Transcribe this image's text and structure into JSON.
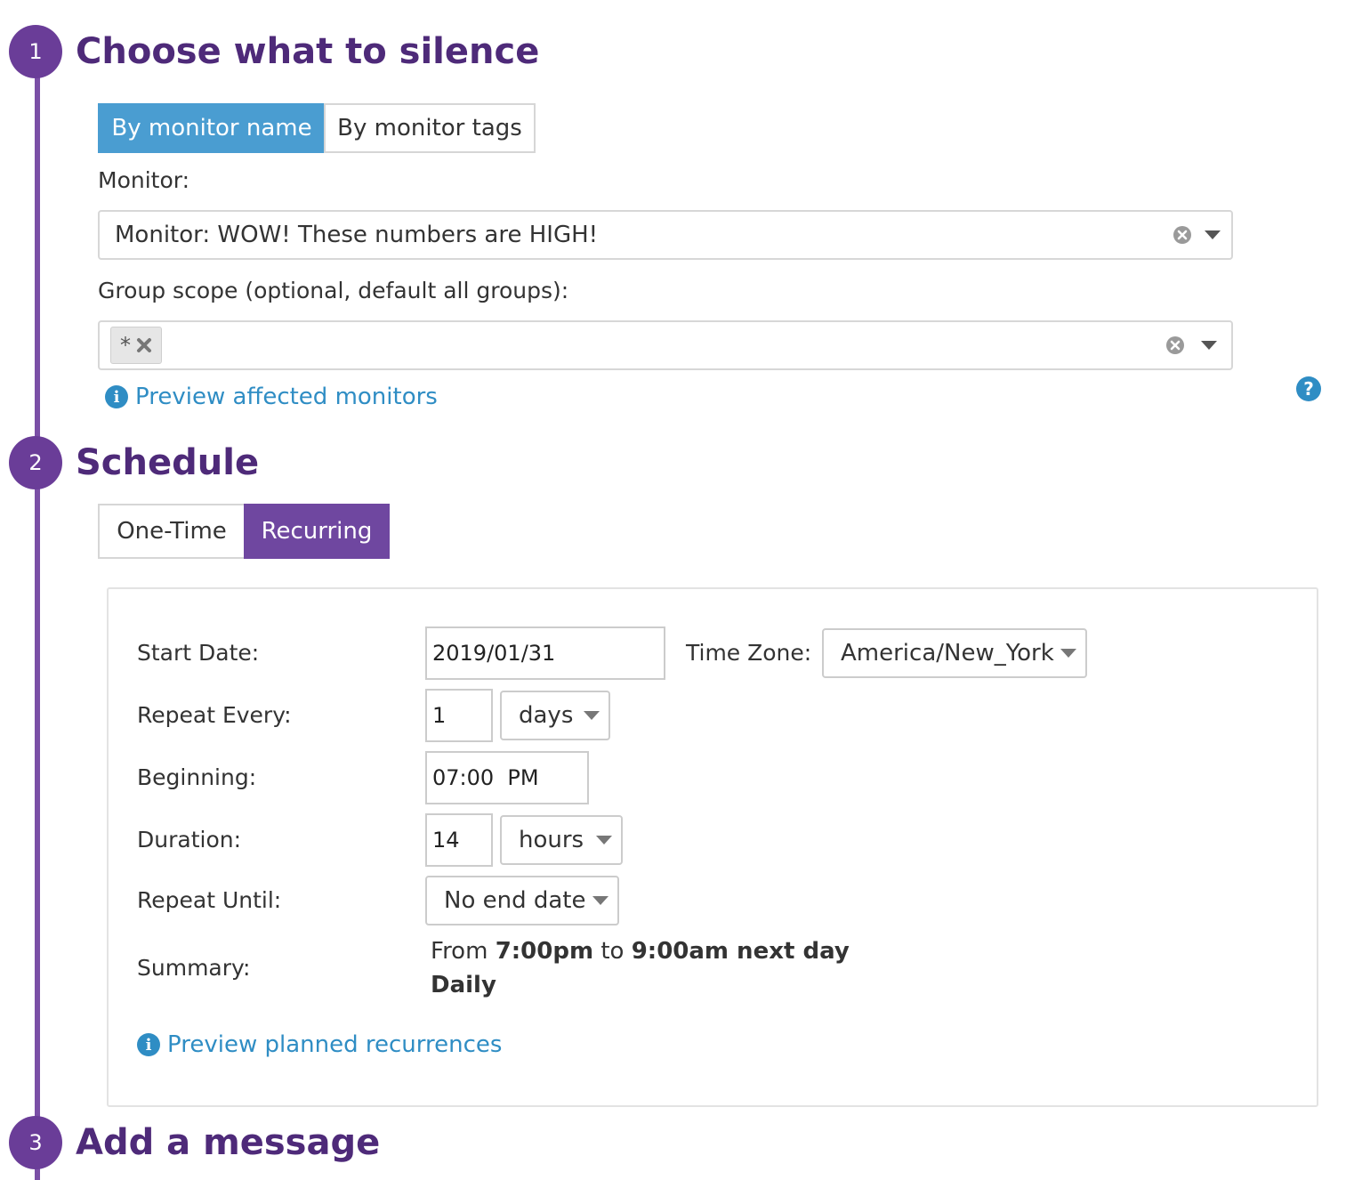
{
  "steps": [
    {
      "number": "1",
      "title": "Choose what to silence"
    },
    {
      "number": "2",
      "title": "Schedule"
    },
    {
      "number": "3",
      "title": "Add a message"
    }
  ],
  "silence": {
    "tabs": [
      {
        "label": "By monitor name",
        "active": true
      },
      {
        "label": "By monitor tags",
        "active": false
      }
    ],
    "monitor_label": "Monitor:",
    "monitor_value": "Monitor: WOW! These numbers are HIGH!",
    "group_scope_label": "Group scope (optional, default all groups):",
    "group_scope_tags": [
      "*"
    ],
    "preview_link": "Preview affected monitors"
  },
  "schedule": {
    "tabs": [
      {
        "label": "One-Time",
        "active": false
      },
      {
        "label": "Recurring",
        "active": true
      }
    ],
    "start_date_label": "Start Date:",
    "start_date_value": "2019/01/31",
    "time_zone_label": "Time Zone:",
    "time_zone_value": "America/New_York",
    "repeat_every_label": "Repeat Every:",
    "repeat_every_value": "1",
    "repeat_every_unit": "days",
    "beginning_label": "Beginning:",
    "beginning_value": "07:00  PM",
    "duration_label": "Duration:",
    "duration_value": "14",
    "duration_unit": "hours",
    "repeat_until_label": "Repeat Until:",
    "repeat_until_value": "No end date",
    "summary_label": "Summary:",
    "summary": {
      "from_word": "From",
      "start_time": "7:00pm",
      "to_word": "to",
      "end_time": "9:00am next day",
      "frequency": "Daily"
    },
    "preview_link": "Preview planned recurrences"
  },
  "colors": {
    "accent_purple": "#6f47a0",
    "accent_blue": "#4a9dd1",
    "link_blue": "#2f8dc4",
    "title_purple": "#4e2a79"
  }
}
